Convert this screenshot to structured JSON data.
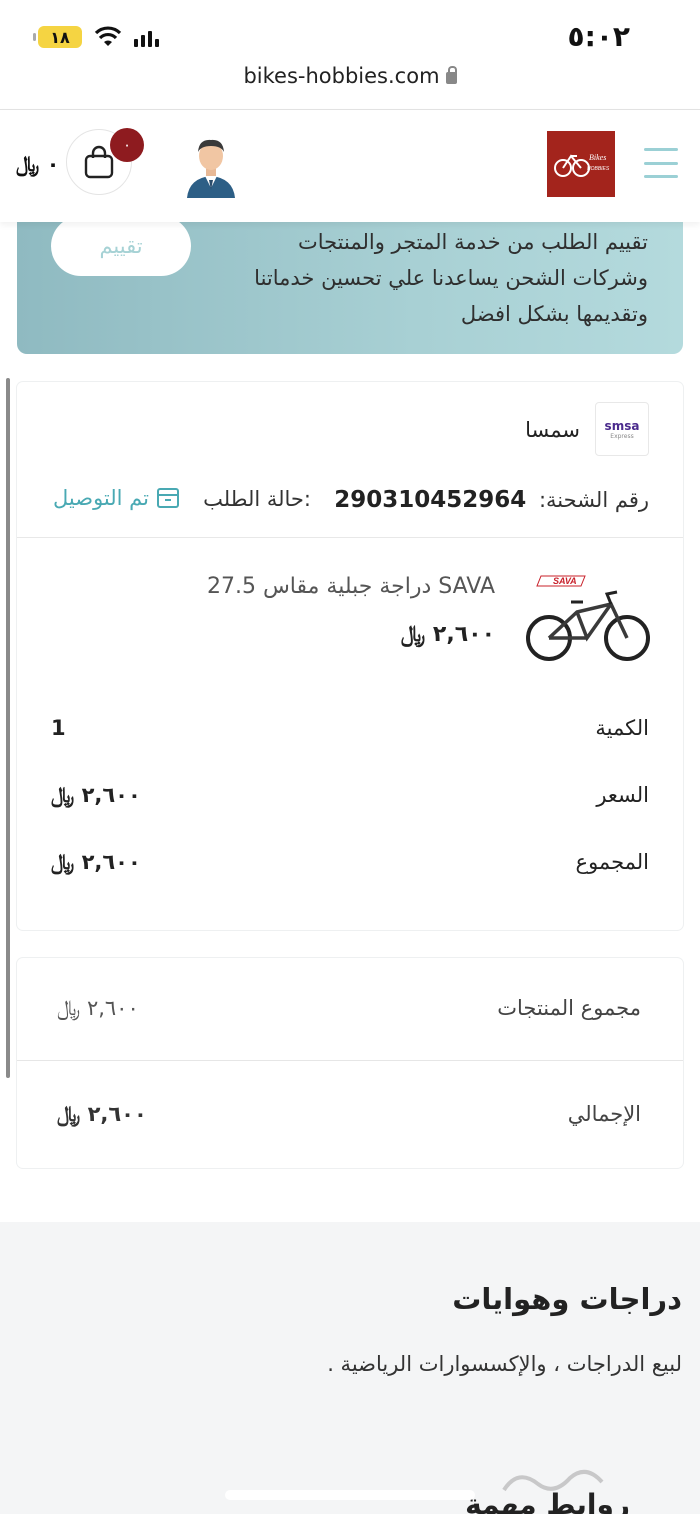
{
  "status_bar": {
    "time": "٥:٠٢",
    "battery": "١٨",
    "url": "bikes-hobbies.com"
  },
  "header": {
    "brand": "Bikes and Hobbies",
    "cart_count": "٠",
    "cart_total": "٠ ﷼",
    "icons": [
      "menu-icon",
      "user-avatar",
      "shopping-bag-icon",
      "lock-icon"
    ]
  },
  "rating_banner": {
    "text": "تقييم الطلب من خدمة المتجر والمنتجات وشركات الشحن يساعدنا علي تحسين خدماتنا وتقديمها بشكل افضل",
    "button_label": "تقييم"
  },
  "order": {
    "carrier_logo_text": "smsa",
    "carrier_logo_sub": "Express",
    "carrier_name": "سمسا",
    "shipment_label": "رقم الشحنة:",
    "shipment_number": "290310452964",
    "status_label": "حالة الطلب:",
    "status_value": "تم التوصيل",
    "product": {
      "image_label": "SAVA",
      "title": "SAVA دراجة جبلية مقاس 27.5",
      "price": "٢,٦٠٠ ﷼"
    },
    "details": [
      {
        "label": "الكمية",
        "value": "1"
      },
      {
        "label": "السعر",
        "value": "٢,٦٠٠ ﷼"
      },
      {
        "label": "المجموع",
        "value": "٢,٦٠٠ ﷼"
      }
    ]
  },
  "totals": {
    "subtotal_label": "مجموع المنتجات",
    "subtotal_value": "٢,٦٠٠ ﷼",
    "grand_label": "الإجمالي",
    "grand_value": "٢,٦٠٠ ﷼"
  },
  "footer": {
    "title": "دراجات وهوايات",
    "description": "لبيع الدراجات ، والإكسسوارات الرياضية .",
    "links_title": "روابط مهمة"
  },
  "colors": {
    "accent": "#49a9b3",
    "banner": "#a8d0d4",
    "badge": "#8e1b1f",
    "brand": "#a3241c"
  }
}
